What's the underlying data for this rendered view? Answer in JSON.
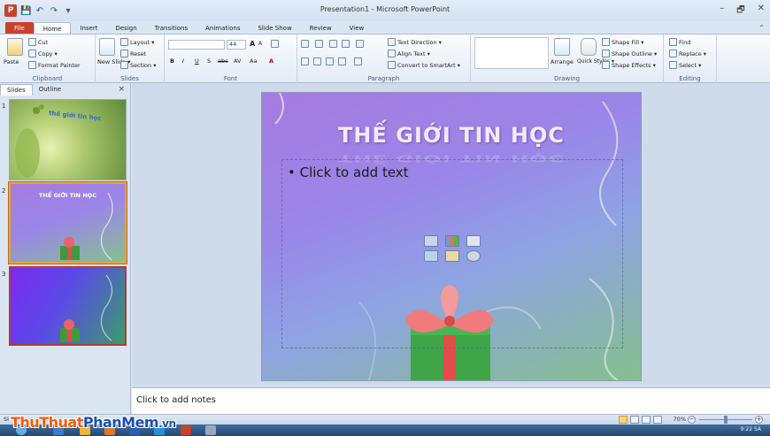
{
  "window": {
    "title": "Presentation1 - Microsoft PowerPoint",
    "app_icon": "P",
    "min": "–",
    "restore": "🗗",
    "close": "✕",
    "qat_save": "💾",
    "qat_undo": "↶",
    "qat_redo": "↷",
    "qat_more": "▾"
  },
  "tabs": [
    "File",
    "Home",
    "Insert",
    "Design",
    "Transitions",
    "Animations",
    "Slide Show",
    "Review",
    "View"
  ],
  "active_tab": "Home",
  "help_icon": "⌃",
  "ribbon": {
    "clipboard": {
      "label": "Clipboard",
      "paste": "Paste",
      "cut": "Cut",
      "copy": "Copy ▾",
      "format_painter": "Format Painter"
    },
    "slides": {
      "label": "Slides",
      "new_slide": "New Slide ▾",
      "layout": "Layout ▾",
      "reset": "Reset",
      "section": "Section ▾"
    },
    "font": {
      "label": "Font",
      "size": "44",
      "bold": "B",
      "italic": "I",
      "underline": "U",
      "shadow": "S",
      "strike": "abc",
      "spacing": "AV",
      "case": "Aa",
      "color": "A",
      "grow": "A",
      "shrink": "A"
    },
    "paragraph": {
      "label": "Paragraph",
      "text_direction": "Text Direction ▾",
      "align_text": "Align Text ▾",
      "convert_smartart": "Convert to SmartArt ▾"
    },
    "drawing": {
      "label": "Drawing",
      "arrange": "Arrange",
      "quick_styles": "Quick Styles ▾",
      "shape_fill": "Shape Fill ▾",
      "shape_outline": "Shape Outline ▾",
      "shape_effects": "Shape Effects ▾"
    },
    "editing": {
      "label": "Editing",
      "find": "Find",
      "replace": "Replace ▾",
      "select": "Select ▾"
    }
  },
  "pane": {
    "tab_slides": "Slides",
    "tab_outline": "Outline",
    "close": "×",
    "thumbs": [
      {
        "num": "1",
        "title": "thế giới tin học"
      },
      {
        "num": "2",
        "title": "THẾ GIỚI TIN HỌC"
      },
      {
        "num": "3",
        "title": ""
      }
    ]
  },
  "slide": {
    "title": "THẾ GIỚI TIN HỌC",
    "bullet": "• Click to add text"
  },
  "notes": {
    "placeholder": "Click to add notes"
  },
  "status": {
    "left": "Sl",
    "zoom": "70%",
    "zoom_minus": "−",
    "zoom_plus": "+"
  },
  "taskbar": {
    "time": "9:22 SA"
  },
  "watermark": {
    "part1": "Thu",
    "part2": "Thuat",
    "part3": "Phan",
    "part4": "Mem",
    "part5": ".vn"
  }
}
